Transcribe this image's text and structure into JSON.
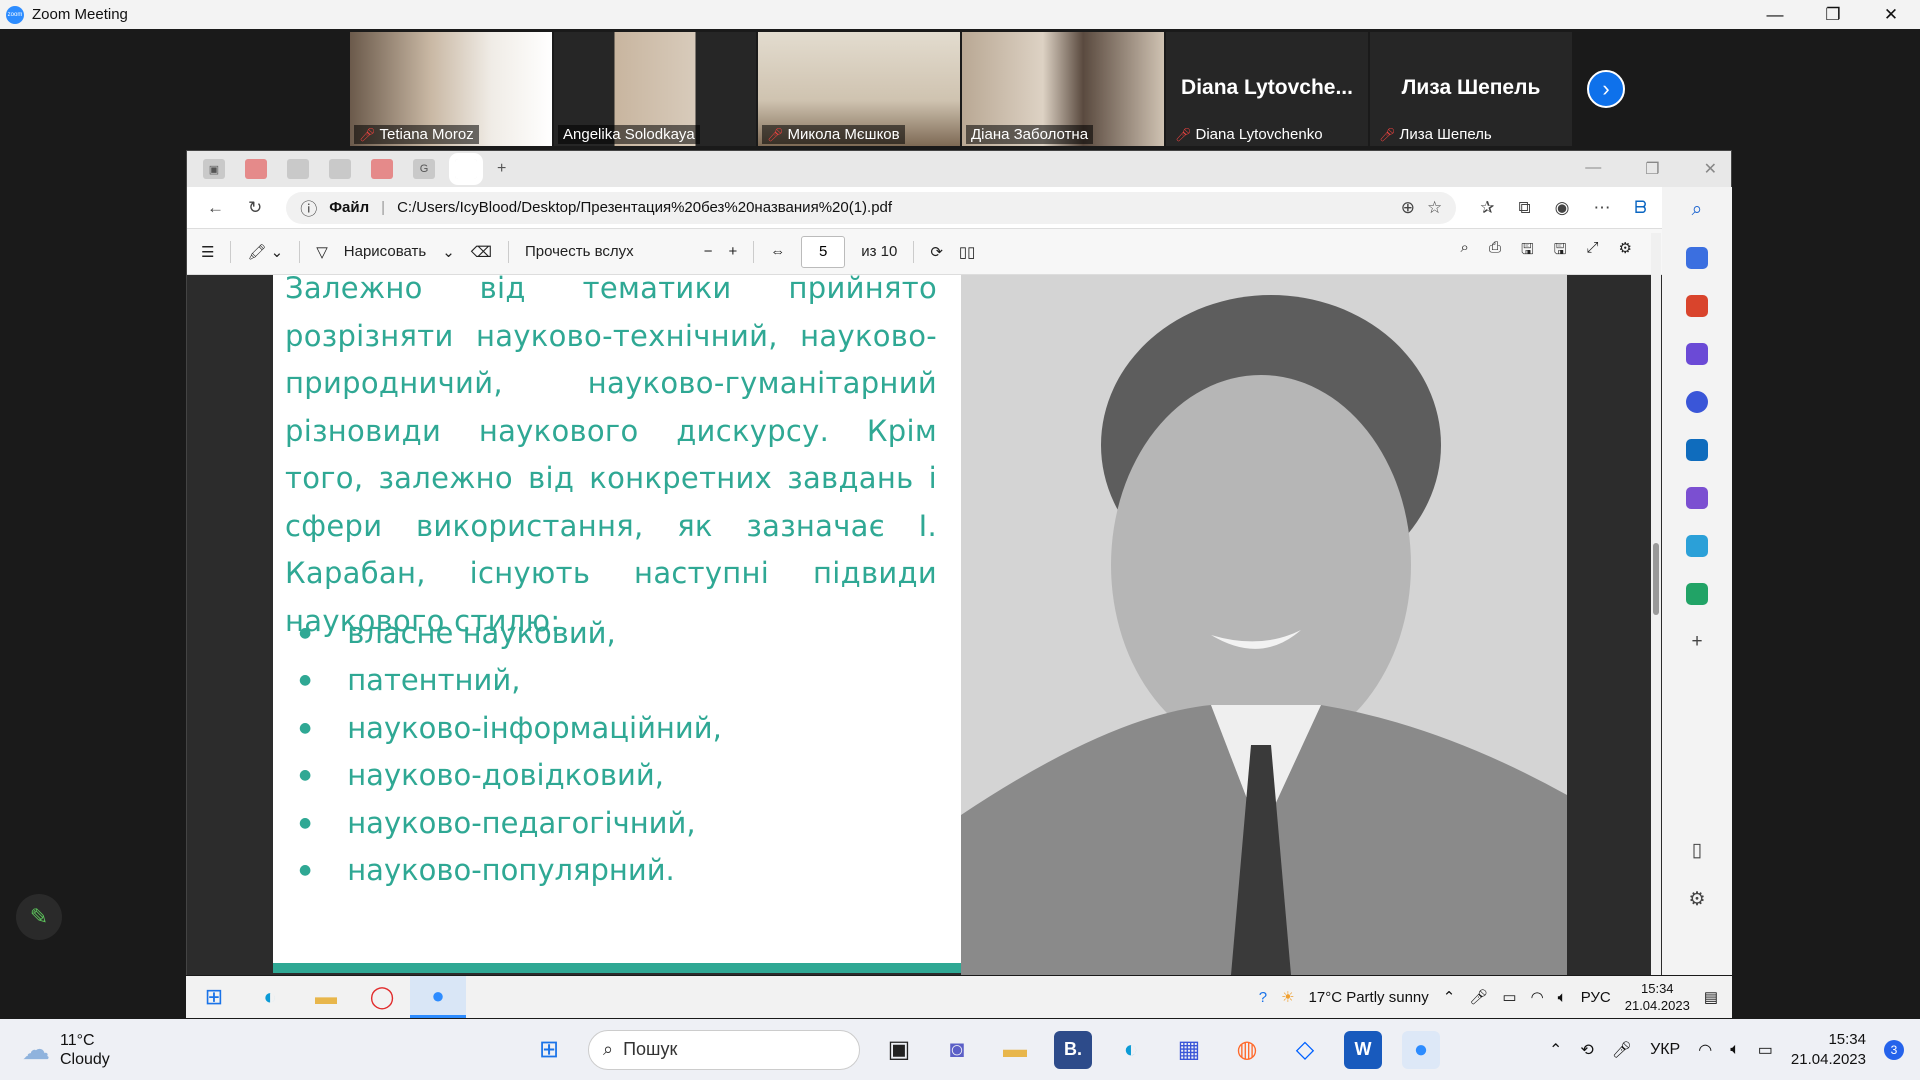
{
  "zoom": {
    "title": "Zoom Meeting",
    "logo_text": "zoom",
    "participants": [
      {
        "name": "Tetiana Moroz",
        "muted": true,
        "video": true
      },
      {
        "name": "Angelika Solodkaya",
        "muted": false,
        "video": true
      },
      {
        "name": "Микола Мєшков",
        "muted": true,
        "video": true
      },
      {
        "name": "Діана Заболотна",
        "muted": false,
        "video": true,
        "active_speaker": true
      },
      {
        "name": "Diana Lytovchenko",
        "display_label": "Diana  Lytovche...",
        "muted": true,
        "video": false
      },
      {
        "name": "Лиза Шепель",
        "display_label": "Лиза Шепель",
        "muted": true,
        "video": false
      }
    ],
    "next_icon": "chevron-right-icon"
  },
  "browser": {
    "file_label": "Файл",
    "url": "C:/Users/IcyBlood/Desktop/Презентация%20без%20названия%20(1).pdf",
    "tab_count_icons": [
      "sidebar-icon",
      "pdf-icon",
      "tab-icon",
      "tab-icon",
      "pdf-icon",
      "google-icon",
      "pdf-icon"
    ],
    "new_tab": "+"
  },
  "pdf_toolbar": {
    "draw_label": "Нарисовать",
    "read_aloud_label": "Прочесть вслух",
    "zoom_out": "−",
    "zoom_in": "+",
    "page": "5",
    "of_pages": "из 10"
  },
  "slide": {
    "paragraph": "Залежно від тематики прийнято розрізняти науково-технічний, науково-природничий, науково-гуманітарний різновиди наукового дискурсу. Крім того, залежно від конкретних завдань і сфери використання, як зазначає І. Карабан, існують наступні підвиди наукового стилю:",
    "bullets": [
      "власне науковий,",
      "патентний,",
      "науково-інформаційний,",
      "науково-довідковий,",
      "науково-педагогічний,",
      "науково-популярний."
    ],
    "accent_color": "#2fa894"
  },
  "inner_taskbar": {
    "weather": "17°C  Partly sunny",
    "lang": "РУС",
    "time": "15:34",
    "date": "21.04.2023"
  },
  "taskbar": {
    "weather_temp": "11°C",
    "weather_desc": "Cloudy",
    "search_placeholder": "Пошук",
    "lang": "УКР",
    "time": "15:34",
    "date": "21.04.2023",
    "notifications": "3"
  }
}
